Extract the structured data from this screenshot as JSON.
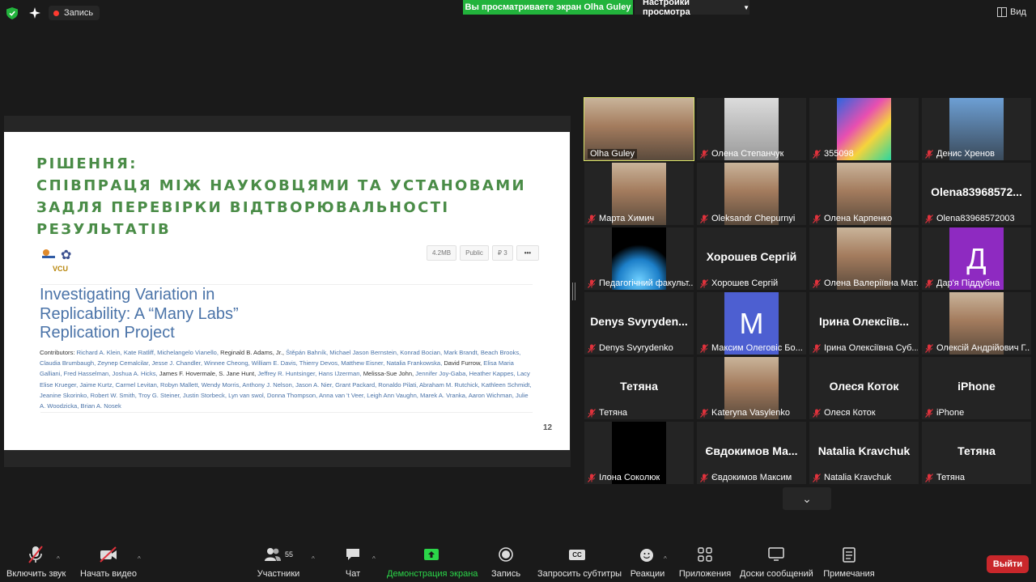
{
  "topbar": {
    "record_label": "Запись",
    "share_banner": "Вы просматриваете экран Olha Guley",
    "view_options": "Настройки просмотра",
    "view_button": "Вид"
  },
  "slide": {
    "title_lines": [
      "РІШЕННЯ:",
      "СПІВПРАЦЯ МІЖ НАУКОВЦЯМИ ТА УСТАНОВАМИ",
      "ЗАДЛЯ ПЕРЕВІРКИ ВІДТВОРЮВАЛЬНОСТІ",
      "РЕЗУЛЬТАТІВ"
    ],
    "logo_text": "VCU",
    "meta_size": "4.2MB",
    "meta_public": "Public",
    "meta_forks": "₽ 3",
    "meta_more": "•••",
    "paper_title_lines": [
      "Investigating Variation in",
      "Replicability: A “Many Labs”",
      "Replication Project"
    ],
    "contributors_label": "Contributors:",
    "contributors": [
      {
        "n": "Richard A. Klein",
        "l": true
      },
      {
        "n": "Kate Ratliff",
        "l": true
      },
      {
        "n": "Michelangelo Vianello",
        "l": true
      },
      {
        "n": "Reginald B. Adams, Jr.",
        "l": false
      },
      {
        "n": "Štěpán Bahník",
        "l": true
      },
      {
        "n": "Michael Jason Bernstein",
        "l": true
      },
      {
        "n": "Konrad Bocian",
        "l": true
      },
      {
        "n": "Mark Brandt",
        "l": true
      },
      {
        "n": "Beach Brooks",
        "l": true
      },
      {
        "n": "Claudia Brumbaugh",
        "l": true
      },
      {
        "n": "Zeynep Cemalcilar",
        "l": true
      },
      {
        "n": "Jesse J. Chandler",
        "l": true
      },
      {
        "n": "Winnee Cheong",
        "l": true
      },
      {
        "n": "William E. Davis",
        "l": true
      },
      {
        "n": "Thierry Devos",
        "l": true
      },
      {
        "n": "Matthew Eisner",
        "l": true
      },
      {
        "n": "Natalia Frankowska",
        "l": true
      },
      {
        "n": "David Furrow",
        "l": false
      },
      {
        "n": "Elisa Maria Galliani",
        "l": true
      },
      {
        "n": "Fred Hasselman",
        "l": true
      },
      {
        "n": "Joshua A. Hicks",
        "l": true
      },
      {
        "n": "James F. Hovermale",
        "l": false
      },
      {
        "n": "S. Jane Hunt",
        "l": false
      },
      {
        "n": "Jeffrey R. Huntsinger",
        "l": true
      },
      {
        "n": "Hans IJzerman",
        "l": true
      },
      {
        "n": "Melissa-Sue John",
        "l": false
      },
      {
        "n": "Jennifer Joy-Gaba",
        "l": true
      },
      {
        "n": "Heather Kappes",
        "l": true
      },
      {
        "n": "Lacy Elise Krueger",
        "l": true
      },
      {
        "n": "Jaime Kurtz",
        "l": true
      },
      {
        "n": "Carmel Levitan",
        "l": true
      },
      {
        "n": "Robyn Mallett",
        "l": true
      },
      {
        "n": "Wendy Morris",
        "l": true
      },
      {
        "n": "Anthony J. Nelson",
        "l": true
      },
      {
        "n": "Jason A. Nier",
        "l": true
      },
      {
        "n": "Grant Packard",
        "l": true
      },
      {
        "n": "Ronaldo Pilati",
        "l": true
      },
      {
        "n": "Abraham M. Rutchick",
        "l": true
      },
      {
        "n": "Kathleen Schmidt",
        "l": true
      },
      {
        "n": "Jeanine Skorinko",
        "l": true
      },
      {
        "n": "Robert W. Smith",
        "l": true
      },
      {
        "n": "Troy G. Steiner",
        "l": true
      },
      {
        "n": "Justin Storbeck",
        "l": true
      },
      {
        "n": "Lyn van swol",
        "l": true
      },
      {
        "n": "Donna Thompson",
        "l": true
      },
      {
        "n": "Anna van 't Veer",
        "l": true
      },
      {
        "n": "Leigh Ann Vaughn",
        "l": true
      },
      {
        "n": "Marek A. Vranka",
        "l": true
      },
      {
        "n": "Aaron Wichman",
        "l": true
      },
      {
        "n": "Julie A. Woodzicka",
        "l": true
      },
      {
        "n": "Brian A. Nosek",
        "l": true
      }
    ],
    "page_number": "12"
  },
  "participants": [
    {
      "name": "Olha Guley",
      "video": "person",
      "muted": false,
      "active": true
    },
    {
      "name": "Олена Степанчук",
      "video": "object",
      "muted": true
    },
    {
      "name": "355098",
      "video": "colorful",
      "muted": true
    },
    {
      "name": "Денис Хренов",
      "video": "sky",
      "muted": true
    },
    {
      "name": "Марта Химич",
      "video": "person",
      "muted": true
    },
    {
      "name": "Oleksandr Chepurnyi",
      "video": "person",
      "muted": true
    },
    {
      "name": "Олена Карпенко",
      "video": "person",
      "muted": true
    },
    {
      "name": "Olena83968572003",
      "big": "Olena83968572...",
      "muted": true
    },
    {
      "name": "Педагогічний факульт...",
      "video": "logo",
      "muted": true
    },
    {
      "name": "Хорошев Сергій",
      "big": "Хорошев Сергій",
      "muted": true
    },
    {
      "name": "Олена Валеріївна Мат...",
      "video": "person",
      "muted": true
    },
    {
      "name": "Дар'я Піддубна",
      "avatar": "Д",
      "avatar_color": "#8e2ac1",
      "muted": true
    },
    {
      "name": "Denys Svyrydenko",
      "big": "Denys Svyryden...",
      "muted": true
    },
    {
      "name": "Максим Олеговic Бо...",
      "avatar": "M",
      "avatar_color": "#4d5fd1",
      "muted": true
    },
    {
      "name": "Ірина Олексіївна  Суб...",
      "big": "Ірина Олексіїв...",
      "muted": true
    },
    {
      "name": "Олексій Андрійович Г...",
      "video": "person",
      "muted": true
    },
    {
      "name": "Тетяна",
      "big": "Тетяна",
      "muted": true
    },
    {
      "name": "Kateryna Vasylenko",
      "video": "person",
      "muted": true
    },
    {
      "name": "Олеся Коток",
      "big": "Олеся Коток",
      "muted": true
    },
    {
      "name": "iPhone",
      "big": "iPhone",
      "muted": true
    },
    {
      "name": "Ілона Соколюк",
      "video": "black",
      "muted": true
    },
    {
      "name": "Євдокимов Максим",
      "big": "Євдокимов Ма...",
      "muted": true
    },
    {
      "name": "Natalia Kravchuk",
      "big": "Natalia Kravchuk",
      "muted": true
    },
    {
      "name": "Тетяна",
      "big": "Тетяна",
      "muted": true
    }
  ],
  "toolbar": {
    "unmute": "Включить звук",
    "start_video": "Начать видео",
    "participants": "Участники",
    "participants_count": "55",
    "chat": "Чат",
    "share_screen": "Демонстрация экрана",
    "record": "Запись",
    "captions": "Запросить субтитры",
    "captions_badge": "CC",
    "reactions": "Реакции",
    "apps": "Приложения",
    "whiteboards": "Доски сообщений",
    "notes": "Примечания",
    "leave": "Выйти"
  },
  "colors": {
    "share_green": "#22b33c",
    "active_border": "#d9e56a",
    "muted_red": "#e0323c",
    "leave_red": "#c9272b",
    "title_green": "#4a8c47",
    "link_blue": "#4a73a8"
  }
}
